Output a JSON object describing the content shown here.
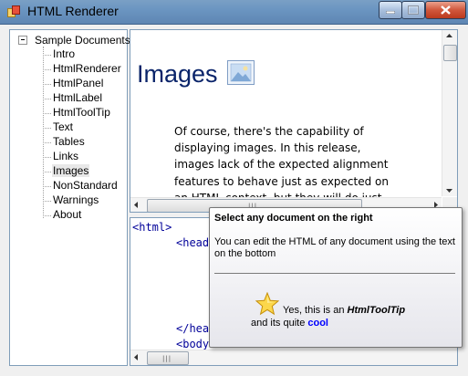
{
  "window": {
    "title": "HTML Renderer"
  },
  "tree": {
    "root": "Sample Documents",
    "items": [
      {
        "label": "Intro"
      },
      {
        "label": "HtmlRenderer"
      },
      {
        "label": "HtmlPanel"
      },
      {
        "label": "HtmlLabel"
      },
      {
        "label": "HtmlToolTip"
      },
      {
        "label": "Text"
      },
      {
        "label": "Tables"
      },
      {
        "label": "Links"
      },
      {
        "label": "Images",
        "selected": true
      },
      {
        "label": "NonStandard"
      },
      {
        "label": "Warnings"
      },
      {
        "label": "About"
      }
    ]
  },
  "render": {
    "title": "Images",
    "paragraph_lines": [
      "Of course, there's the capability of",
      "displaying images. In this release,",
      "images lack of the expected alignment",
      "features to behave just as expected on",
      "an HTML context, but they will do just"
    ]
  },
  "editor": {
    "lines": [
      "<html>",
      "<head",
      "</hea",
      "<body"
    ]
  },
  "tooltip": {
    "title": "Select any document on the right",
    "body": "You can edit the HTML of any document using the text on the bottom",
    "line1_prefix": "Yes, this is an ",
    "line1_bold": "HtmlToolTip",
    "line2_prefix": "and its quite ",
    "line2_highlight": "cool"
  },
  "colors": {
    "heading": "#0a246a",
    "code": "#000099",
    "highlight": "#0000ff"
  },
  "icons": {
    "app": "app-icon",
    "image": "image-icon",
    "star": "star-icon"
  }
}
